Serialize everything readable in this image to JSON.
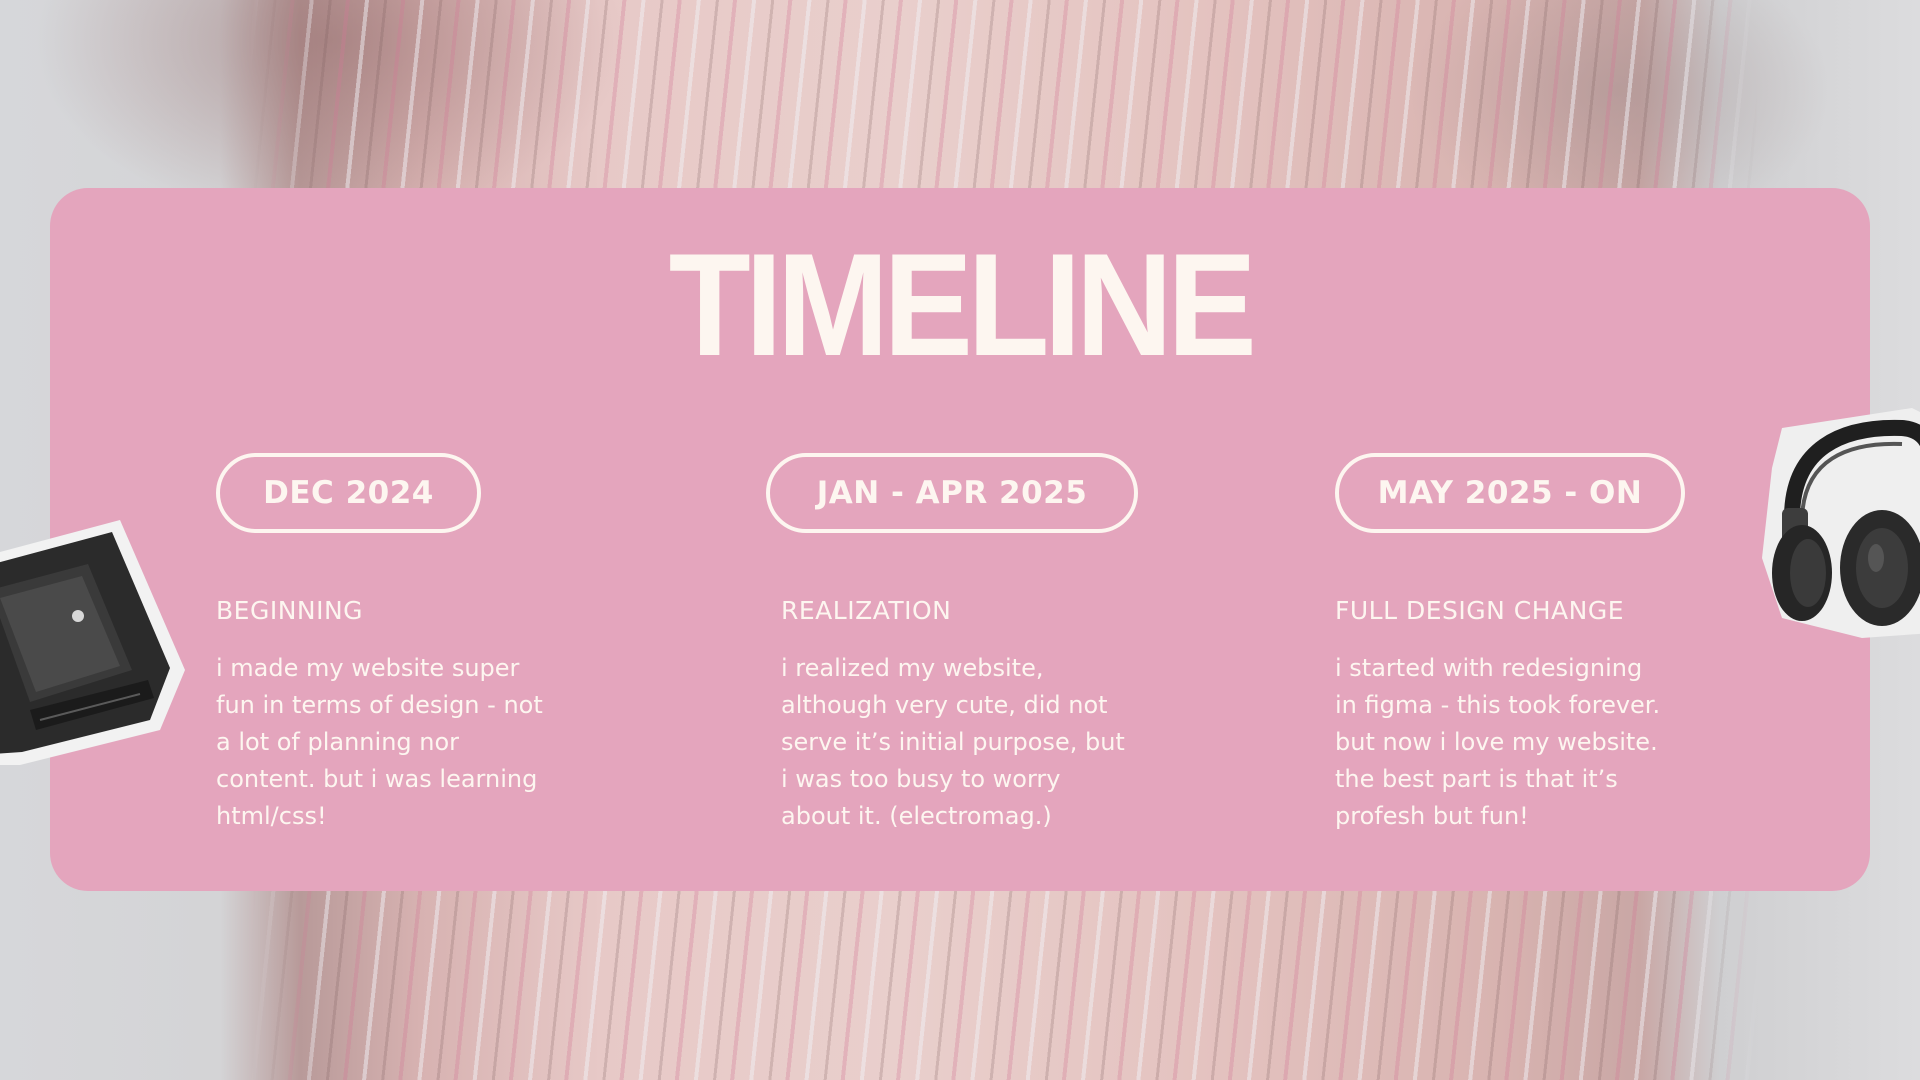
{
  "title": "TIMELINE",
  "colors": {
    "card": "#e4a5bd",
    "text": "#fdf6f0"
  },
  "stickers": {
    "left": "retro-tv",
    "right": "headphones"
  },
  "timeline": [
    {
      "date": "DEC 2024",
      "heading": "BEGINNING",
      "lines": [
        "i made my website super",
        "fun in terms of design - not",
        "a lot of planning nor",
        "content. but i was learning",
        "html/css!"
      ]
    },
    {
      "date": "JAN - APR 2025",
      "heading": "REALIZATION",
      "lines": [
        "i realized my website,",
        "although very cute, did not",
        "serve it’s initial purpose, but",
        "i was too busy to worry",
        "about it. (electromag.)"
      ]
    },
    {
      "date": "MAY 2025 - ON",
      "heading": "FULL DESIGN CHANGE",
      "lines": [
        "i started with redesigning",
        "in figma - this took forever.",
        "but now i love my website.",
        "the best part is that it’s",
        "profesh but fun!"
      ]
    }
  ]
}
